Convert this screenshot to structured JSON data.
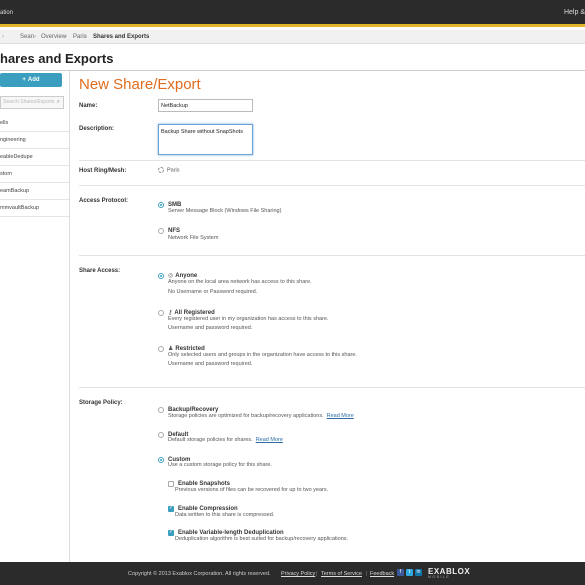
{
  "topbar": {
    "brand": "ation",
    "help": "Help &"
  },
  "breadcrumb": {
    "items": [
      "Sean",
      "Overview",
      "Paris",
      "Shares and Exports"
    ]
  },
  "page": {
    "title": "hares and Exports"
  },
  "sidebar": {
    "add_label": "Add",
    "search_placeholder": "Search Shares/Exports",
    "items": [
      "ells",
      "ngineering",
      "eableDedupe",
      "stom",
      "eamBackup",
      "mmvaultBackup"
    ]
  },
  "form": {
    "title": "New Share/Export",
    "name_label": "Name:",
    "name_value": "NetBackup",
    "description_label": "Description:",
    "description_value": "Backup Share without SnapShots",
    "host_label": "Host Ring/Mesh:",
    "host_value": "Paris",
    "access_protocol": {
      "label": "Access Protocol:",
      "options": [
        {
          "label": "SMB",
          "desc": "Server Message Block (Windows File Sharing)",
          "selected": true
        },
        {
          "label": "NFS",
          "desc": "Network File System",
          "selected": false
        }
      ]
    },
    "share_access": {
      "label": "Share Access:",
      "options": [
        {
          "label": "Anyone",
          "icon": "globe-icon",
          "desc1": "Anyone on the local area network has access to this share.",
          "desc2": "No Username or Password required.",
          "selected": true
        },
        {
          "label": "All Registered",
          "icon": "key-icon",
          "desc1": "Every registered user in my organization has access to this share.",
          "desc2": "Username and password required.",
          "selected": false
        },
        {
          "label": "Restricted",
          "icon": "users-icon",
          "desc1": "Only selected users and groups in the organization have access to this share.",
          "desc2": "Username and password required.",
          "selected": false
        }
      ]
    },
    "storage_policy": {
      "label": "Storage Policy:",
      "read_more": "Read More",
      "options": [
        {
          "label": "Backup/Recovery",
          "desc": "Storage policies are optimized for backup/recovery applications.",
          "selected": false
        },
        {
          "label": "Default",
          "desc": "Default storage policies for shares.",
          "selected": false
        },
        {
          "label": "Custom",
          "desc": "Use a custom storage policy for this share.",
          "selected": true
        }
      ],
      "custom_options": [
        {
          "label": "Enable Snapshots",
          "desc": "Previous versions of files can be recovered for up to two years.",
          "checked": false
        },
        {
          "label": "Enable Compression",
          "desc": "Data written to this share is compressed.",
          "checked": true
        },
        {
          "label": "Enable Variable-length Deduplication",
          "desc": "Deduplication algorithm is best suited for backup/recovery applications.",
          "checked": true
        }
      ]
    }
  },
  "footer": {
    "copyright": "Copyright © 2013 Exablox Corporation. All rights reserved.",
    "privacy": "Privacy Policy",
    "terms": "Terms of Service",
    "feedback": "Feedback",
    "logo": "EXABLOX",
    "logo_sub": "MOBILE"
  },
  "colors": {
    "accent": "#3a9fbf",
    "title_orange": "#e06c1d",
    "header_bg": "#2b2b2b",
    "header_stripe": "#e2b62b"
  }
}
